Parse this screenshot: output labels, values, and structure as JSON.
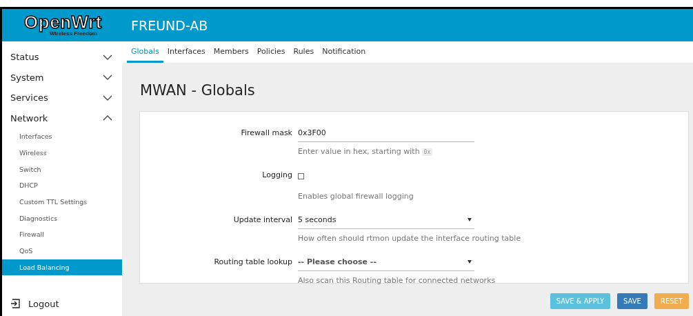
{
  "logo": {
    "name": "OpenWrt",
    "tagline": "Wireless Freedom"
  },
  "header": {
    "hostname": "FREUND-AB"
  },
  "sidebar": {
    "items": [
      {
        "label": "Status",
        "expanded": false
      },
      {
        "label": "System",
        "expanded": false
      },
      {
        "label": "Services",
        "expanded": false
      },
      {
        "label": "Network",
        "expanded": true,
        "children": [
          {
            "label": "Interfaces",
            "selected": false
          },
          {
            "label": "Wireless",
            "selected": false
          },
          {
            "label": "Switch",
            "selected": false
          },
          {
            "label": "DHCP",
            "selected": false
          },
          {
            "label": "Custom TTL Settings",
            "selected": false
          },
          {
            "label": "Diagnostics",
            "selected": false
          },
          {
            "label": "Firewall",
            "selected": false
          },
          {
            "label": "QoS",
            "selected": false
          },
          {
            "label": "Load Balancing",
            "selected": true
          }
        ]
      }
    ],
    "logout": "Logout"
  },
  "tabs": [
    {
      "label": "Globals",
      "selected": true
    },
    {
      "label": "Interfaces",
      "selected": false
    },
    {
      "label": "Members",
      "selected": false
    },
    {
      "label": "Policies",
      "selected": false
    },
    {
      "label": "Rules",
      "selected": false
    },
    {
      "label": "Notification",
      "selected": false
    }
  ],
  "page_title": "MWAN - Globals",
  "fields": [
    {
      "kind": "text",
      "label": "Firewall mask",
      "value": "0x3F00",
      "description": "Enter value in hex, starting with",
      "description_code": "0x"
    },
    {
      "kind": "checkbox",
      "label": "Logging",
      "checked": false,
      "description": "Enables global firewall logging"
    },
    {
      "kind": "select",
      "label": "Update interval",
      "value": "5 seconds",
      "description": "How often should rtmon update the interface routing table"
    },
    {
      "kind": "select",
      "label": "Routing table lookup",
      "placeholder": "-- Please choose --",
      "description": "Also scan this Routing table for connected networks"
    }
  ],
  "buttons": [
    {
      "kind": "apply",
      "label": "SAVE & APPLY"
    },
    {
      "kind": "save",
      "label": "SAVE"
    },
    {
      "kind": "reset",
      "label": "RESET"
    }
  ]
}
